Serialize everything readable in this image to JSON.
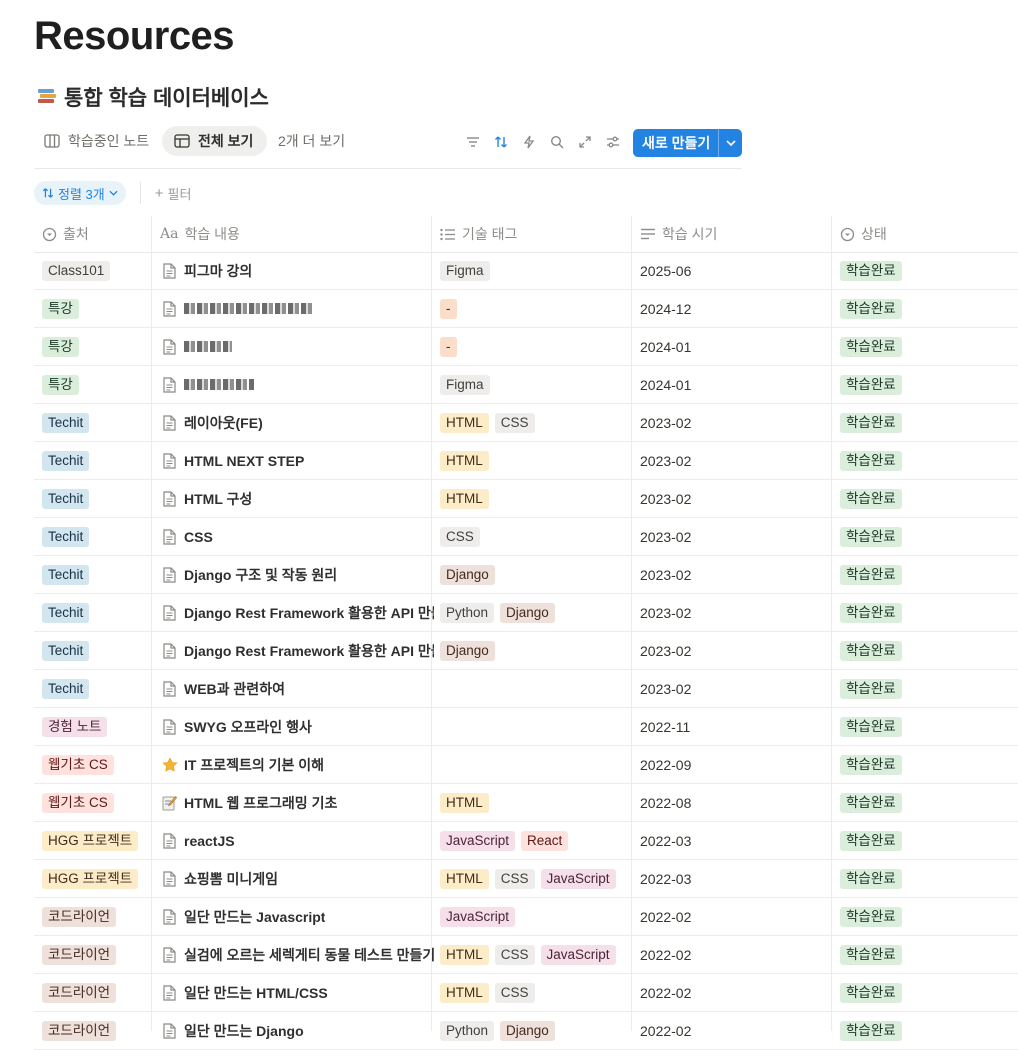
{
  "page": {
    "title": "Resources"
  },
  "database": {
    "title": "통합 학습 데이터베이스"
  },
  "views": {
    "tab1": "학습중인 노트",
    "tab2": "전체 보기",
    "more": "2개 더 보기",
    "new_button": "새로 만들기",
    "icons": [
      "filter-icon",
      "sort-icon",
      "lightning-icon",
      "search-icon",
      "expand-icon",
      "settings-icon"
    ]
  },
  "filters": {
    "sort_label": "정렬 3개",
    "filter_label": "필터"
  },
  "columns": {
    "source": "출처",
    "content": "학습 내용",
    "tags": "기술 태그",
    "date": "학습 시기",
    "status": "상태"
  },
  "tag_colors": {
    "Class101": "gray",
    "특강": "green",
    "Techit": "blue",
    "경험 노트": "pink",
    "웹기초 CS": "red",
    "HGG 프로젝트": "yellow",
    "코드라이언": "brown",
    "Figma": "gray",
    "-": "orange",
    "HTML": "yellow",
    "CSS": "gray",
    "Django": "brown",
    "Python": "gray",
    "JavaScript": "pink",
    "React": "red",
    "학습완료": "green"
  },
  "rows": [
    {
      "source": "Class101",
      "icon": "doc",
      "title": "피그마 강의",
      "tags": [
        "Figma"
      ],
      "date": "2025-06",
      "status": "학습완료"
    },
    {
      "source": "특강",
      "icon": "doc",
      "title": "",
      "blurred": true,
      "tags": [
        "-"
      ],
      "date": "2024-12",
      "status": "학습완료"
    },
    {
      "source": "특강",
      "icon": "doc",
      "title": "",
      "blurred": true,
      "tags": [
        "-"
      ],
      "date": "2024-01",
      "status": "학습완료"
    },
    {
      "source": "특강",
      "icon": "doc",
      "title": "",
      "blurred": true,
      "tags": [
        "Figma"
      ],
      "date": "2024-01",
      "status": "학습완료"
    },
    {
      "source": "Techit",
      "icon": "doc",
      "title": "레이아웃(FE)",
      "tags": [
        "HTML",
        "CSS"
      ],
      "date": "2023-02",
      "status": "학습완료"
    },
    {
      "source": "Techit",
      "icon": "doc",
      "title": "HTML NEXT STEP",
      "tags": [
        "HTML"
      ],
      "date": "2023-02",
      "status": "학습완료"
    },
    {
      "source": "Techit",
      "icon": "doc",
      "title": "HTML 구성",
      "tags": [
        "HTML"
      ],
      "date": "2023-02",
      "status": "학습완료"
    },
    {
      "source": "Techit",
      "icon": "doc",
      "title": "CSS",
      "tags": [
        "CSS"
      ],
      "date": "2023-02",
      "status": "학습완료"
    },
    {
      "source": "Techit",
      "icon": "doc",
      "title": "Django 구조 및 작동 원리",
      "tags": [
        "Django"
      ],
      "date": "2023-02",
      "status": "학습완료"
    },
    {
      "source": "Techit",
      "icon": "doc",
      "title": "Django Rest Framework 활용한 API 만들",
      "tags": [
        "Python",
        "Django"
      ],
      "date": "2023-02",
      "status": "학습완료"
    },
    {
      "source": "Techit",
      "icon": "doc",
      "title": "Django Rest Framework 활용한 API 만들",
      "tags": [
        "Django"
      ],
      "date": "2023-02",
      "status": "학습완료"
    },
    {
      "source": "Techit",
      "icon": "doc",
      "title": "WEB과 관련하여",
      "tags": [],
      "date": "2023-02",
      "status": "학습완료"
    },
    {
      "source": "경험 노트",
      "icon": "doc",
      "title": "SWYG 오프라인 행사",
      "tags": [],
      "date": "2022-11",
      "status": "학습완료"
    },
    {
      "source": "웹기초 CS",
      "icon": "star",
      "title": "IT 프로젝트의 기본 이해",
      "tags": [],
      "date": "2022-09",
      "status": "학습완료"
    },
    {
      "source": "웹기초 CS",
      "icon": "memo",
      "title": "HTML 웹 프로그래밍 기초",
      "tags": [
        "HTML"
      ],
      "date": "2022-08",
      "status": "학습완료"
    },
    {
      "source": "HGG 프로젝트",
      "icon": "doc",
      "title": "reactJS",
      "tags": [
        "JavaScript",
        "React"
      ],
      "date": "2022-03",
      "status": "학습완료"
    },
    {
      "source": "HGG 프로젝트",
      "icon": "doc",
      "title": "쇼핑뽐 미니게임",
      "tags": [
        "HTML",
        "CSS",
        "JavaScript"
      ],
      "date": "2022-03",
      "status": "학습완료"
    },
    {
      "source": "코드라이언",
      "icon": "doc",
      "title": "일단 만드는 Javascript",
      "tags": [
        "JavaScript"
      ],
      "date": "2022-02",
      "status": "학습완료"
    },
    {
      "source": "코드라이언",
      "icon": "doc",
      "title": "실검에 오르는 세렉게티 동물 테스트 만들기",
      "tags": [
        "HTML",
        "CSS",
        "JavaScript"
      ],
      "date": "2022-02",
      "status": "학습완료"
    },
    {
      "source": "코드라이언",
      "icon": "doc",
      "title": "일단 만드는 HTML/CSS",
      "tags": [
        "HTML",
        "CSS"
      ],
      "date": "2022-02",
      "status": "학습완료"
    },
    {
      "source": "코드라이언",
      "icon": "doc",
      "title": "일단 만드는 Django",
      "tags": [
        "Python",
        "Django"
      ],
      "date": "2022-02",
      "status": "학습완료"
    }
  ]
}
